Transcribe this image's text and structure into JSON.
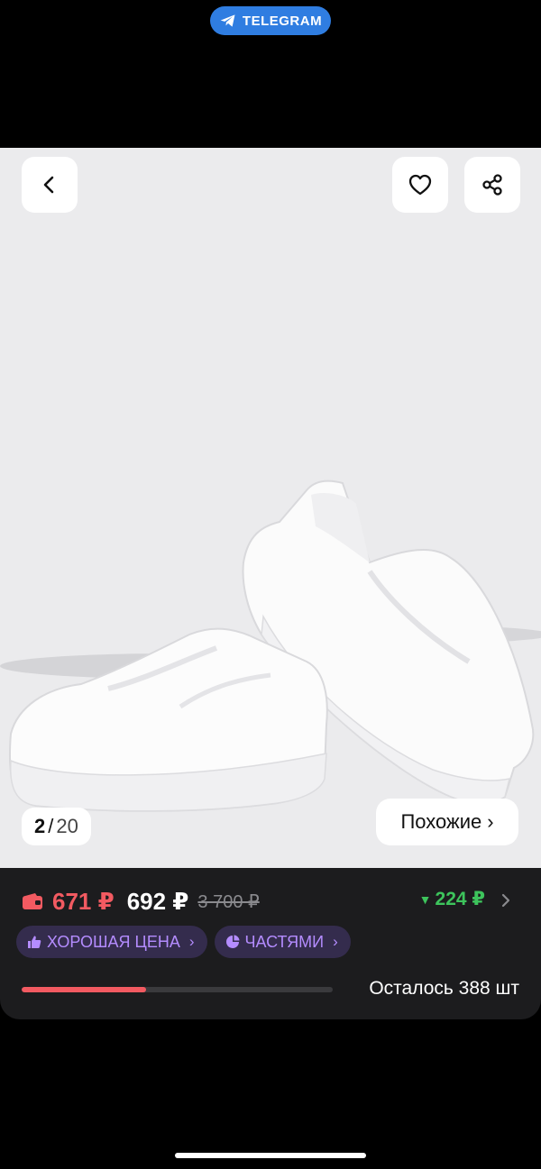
{
  "telegram_pill": {
    "label": "TELEGRAM"
  },
  "gallery": {
    "counter_current": "2",
    "counter_separator": "/",
    "counter_total": "20",
    "similar_label": "Похожие",
    "similar_chevron": "›"
  },
  "pricing": {
    "card_price": "671 ₽",
    "price": "692 ₽",
    "old_price": "3 700 ₽",
    "discount_arrow": "▼",
    "discount": "224 ₽"
  },
  "badges": [
    {
      "label": "ХОРОШАЯ ЦЕНА",
      "icon": "thumbs-up-icon",
      "chevron": "›"
    },
    {
      "label": "ЧАСТЯМИ",
      "icon": "pie-chart-icon",
      "chevron": "›"
    }
  ],
  "stock": {
    "text": "Осталось 388 шт",
    "remaining_fraction": 0.4
  },
  "colors": {
    "accent_red": "#f25a61",
    "accent_green": "#3dc45c",
    "badge_purple": "#b48cff",
    "telegram_blue": "#2f7de1"
  }
}
